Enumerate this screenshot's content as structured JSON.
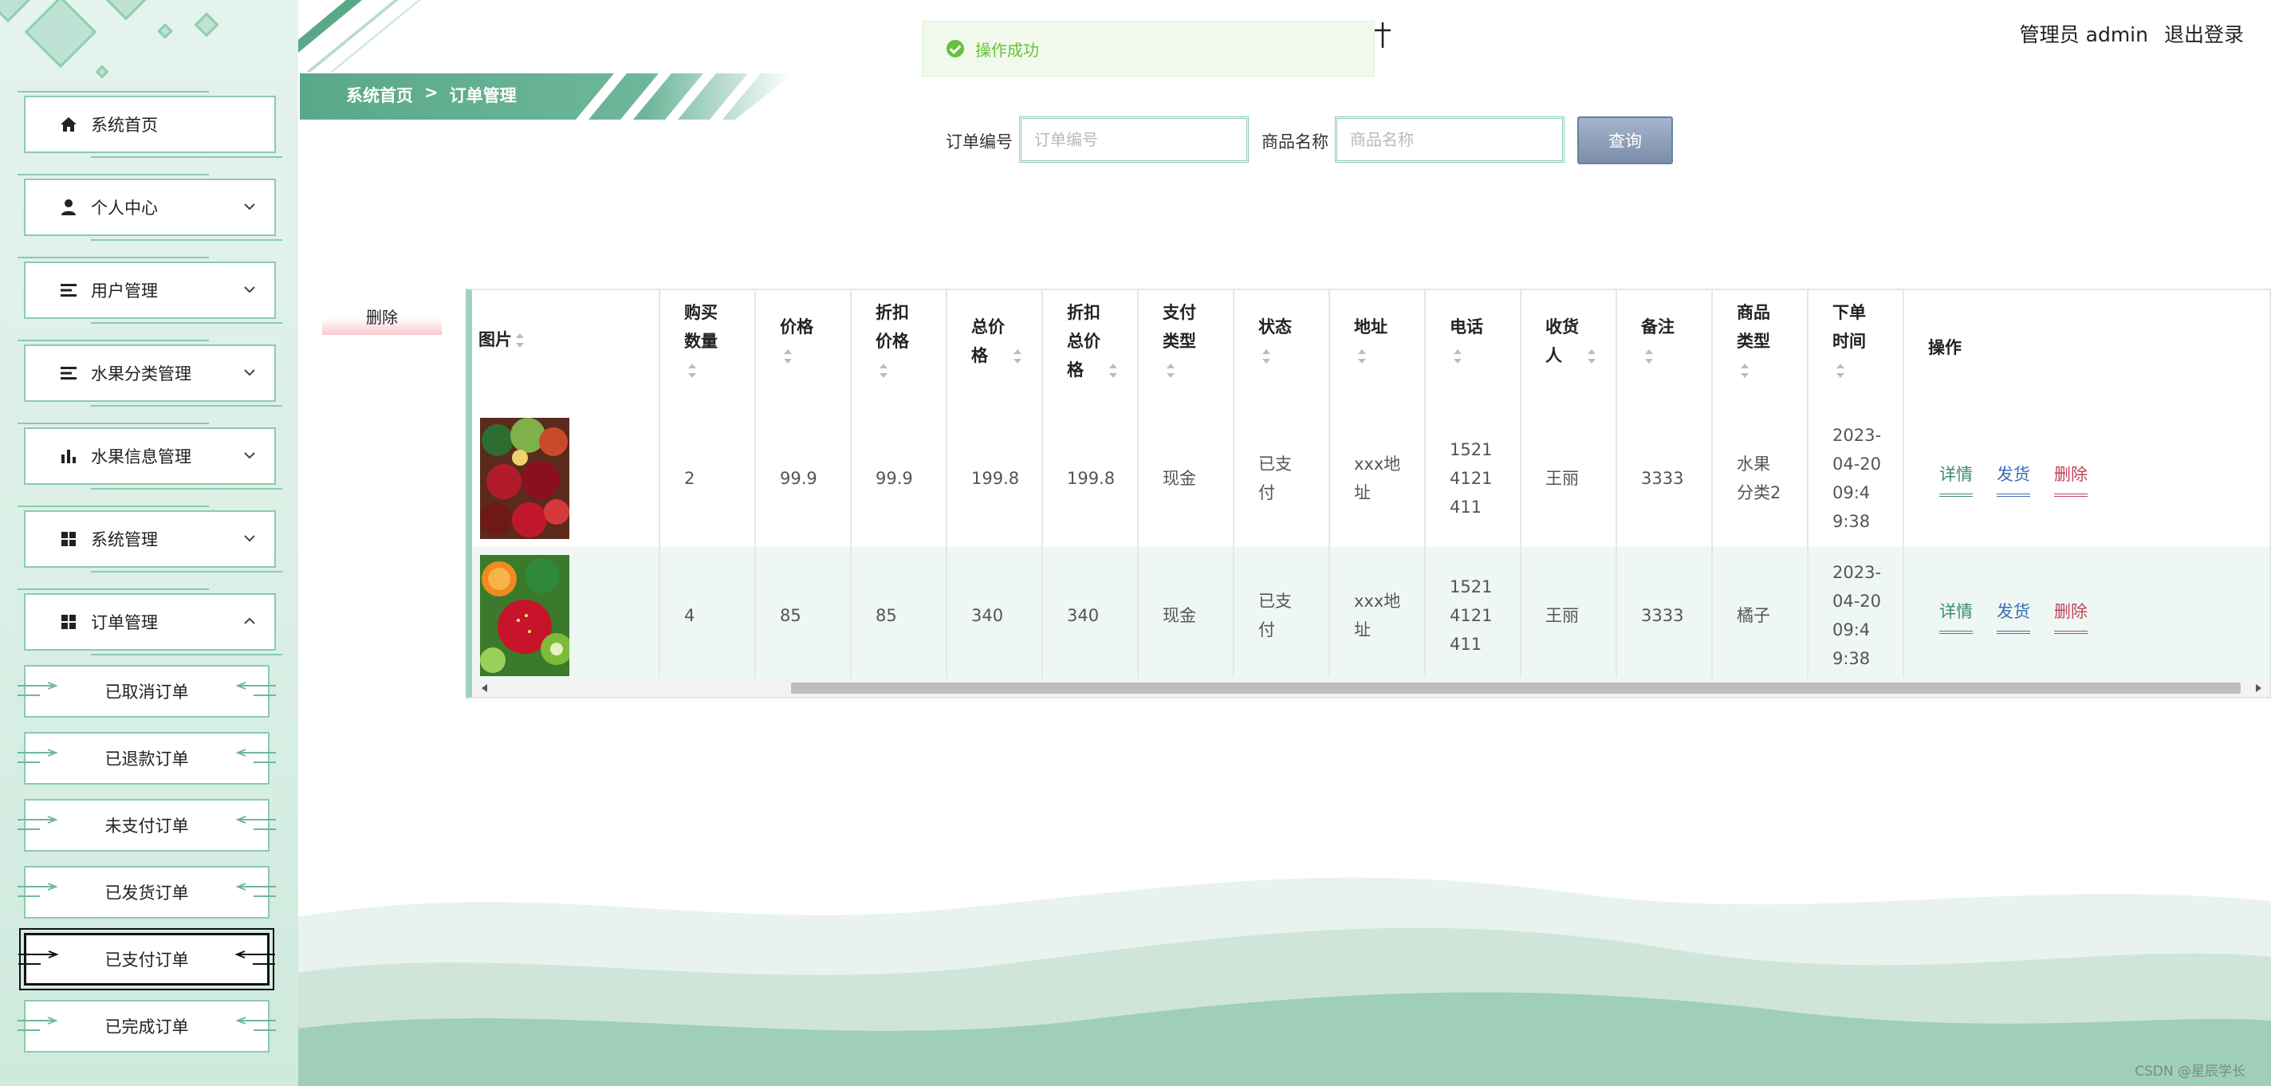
{
  "colors": {
    "accent": "#5aa889",
    "sidebar_bg": "#e4f3ec",
    "success": "#67c23a",
    "link_detail": "#3f8a6e",
    "link_ship": "#3b6fb5",
    "link_delete": "#c0435a",
    "search_button": "#8a9bb5"
  },
  "sidebar": {
    "items": [
      {
        "label": "系统首页",
        "icon": "home-icon",
        "has_chevron": false
      },
      {
        "label": "个人中心",
        "icon": "user-icon",
        "has_chevron": true
      },
      {
        "label": "用户管理",
        "icon": "list-icon",
        "has_chevron": true
      },
      {
        "label": "水果分类管理",
        "icon": "list-icon",
        "has_chevron": true
      },
      {
        "label": "水果信息管理",
        "icon": "bar-chart-icon",
        "has_chevron": true
      },
      {
        "label": "系统管理",
        "icon": "grid-icon",
        "has_chevron": true
      },
      {
        "label": "订单管理",
        "icon": "grid-icon",
        "has_chevron": true,
        "expanded": true
      }
    ],
    "sub_items": [
      {
        "label": "已取消订单"
      },
      {
        "label": "已退款订单"
      },
      {
        "label": "未支付订单"
      },
      {
        "label": "已发货订单"
      },
      {
        "label": "已支付订单",
        "active": true
      },
      {
        "label": "已完成订单"
      }
    ]
  },
  "breadcrumb": {
    "home": "系统首页",
    "separator": ">",
    "current": "订单管理"
  },
  "toast": {
    "message": "操作成功"
  },
  "header": {
    "role": "管理员",
    "username": "admin",
    "logout": "退出登录"
  },
  "search": {
    "order_no_label": "订单编号",
    "order_no_placeholder": "订单编号",
    "product_label": "商品名称",
    "product_placeholder": "商品名称",
    "query_button": "查询"
  },
  "actions": {
    "batch_delete": "删除"
  },
  "table": {
    "columns": [
      {
        "key": "image",
        "label": "图片",
        "sortable": true
      },
      {
        "key": "qty",
        "label": "购买数量",
        "sortable": true
      },
      {
        "key": "price",
        "label": "价格",
        "sortable": true
      },
      {
        "key": "discount_price",
        "label": "折扣价格",
        "sortable": true
      },
      {
        "key": "total",
        "label": "总价格",
        "sortable": true
      },
      {
        "key": "discount_total",
        "label": "折扣总价格",
        "sortable": true
      },
      {
        "key": "pay_type",
        "label": "支付类型",
        "sortable": true
      },
      {
        "key": "status",
        "label": "状态",
        "sortable": true
      },
      {
        "key": "address",
        "label": "地址",
        "sortable": true
      },
      {
        "key": "phone",
        "label": "电话",
        "sortable": true
      },
      {
        "key": "receiver",
        "label": "收货人",
        "sortable": true
      },
      {
        "key": "note",
        "label": "备注",
        "sortable": true
      },
      {
        "key": "category",
        "label": "商品类型",
        "sortable": true
      },
      {
        "key": "order_time",
        "label": "下单时间",
        "sortable": true
      },
      {
        "key": "ops",
        "label": "操作",
        "sortable": false
      }
    ],
    "rows": [
      {
        "qty": "2",
        "price": "99.9",
        "discount_price": "99.9",
        "total": "199.8",
        "discount_total": "199.8",
        "pay_type": "现金",
        "status": "已支付",
        "address": "xxx地址",
        "phone": "15214121411",
        "receiver": "王丽",
        "note": "3333",
        "category": "水果分类2",
        "order_time": "2023-04-20 09:49:38"
      },
      {
        "qty": "4",
        "price": "85",
        "discount_price": "85",
        "total": "340",
        "discount_total": "340",
        "pay_type": "现金",
        "status": "已支付",
        "address": "xxx地址",
        "phone": "15214121411",
        "receiver": "王丽",
        "note": "3333",
        "category": "橘子",
        "order_time": "2023-04-20 09:49:38"
      }
    ],
    "row_actions": {
      "detail": "详情",
      "ship": "发货",
      "delete": "删除"
    }
  },
  "watermark": "CSDN @星辰学长"
}
